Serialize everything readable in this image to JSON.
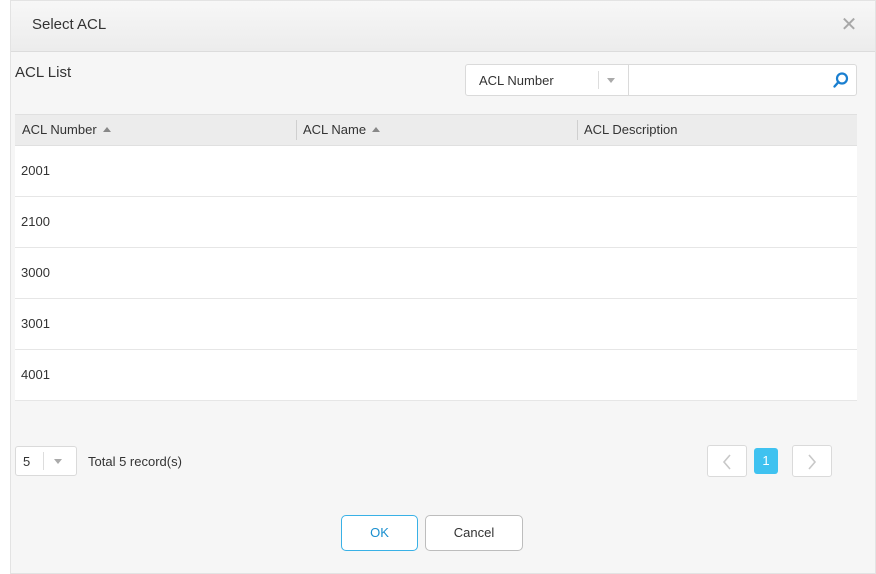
{
  "dialog": {
    "title": "Select ACL",
    "close_glyph": "✕",
    "list_title": "ACL List"
  },
  "search": {
    "field_selected": "ACL Number",
    "placeholder": "",
    "value": ""
  },
  "table": {
    "columns": [
      "ACL Number",
      "ACL Name",
      "ACL Description"
    ],
    "sort_indicator": "ascending",
    "rows": [
      {
        "number": "2001",
        "name": "",
        "description": ""
      },
      {
        "number": "2100",
        "name": "",
        "description": ""
      },
      {
        "number": "3000",
        "name": "",
        "description": ""
      },
      {
        "number": "3001",
        "name": "",
        "description": ""
      },
      {
        "number": "4001",
        "name": "",
        "description": ""
      }
    ]
  },
  "pagination": {
    "page_size": "5",
    "total_text": "Total 5 record(s)",
    "current_page": "1"
  },
  "buttons": {
    "ok": "OK",
    "cancel": "Cancel"
  },
  "colors": {
    "accent": "#3fc2f0",
    "ok_border": "#39b1e6",
    "search_icon": "#1a7fd0"
  },
  "icons": [
    "close-icon",
    "search-icon",
    "chevron-down-icon",
    "sort-asc-icon",
    "chevron-left-icon",
    "chevron-right-icon"
  ]
}
